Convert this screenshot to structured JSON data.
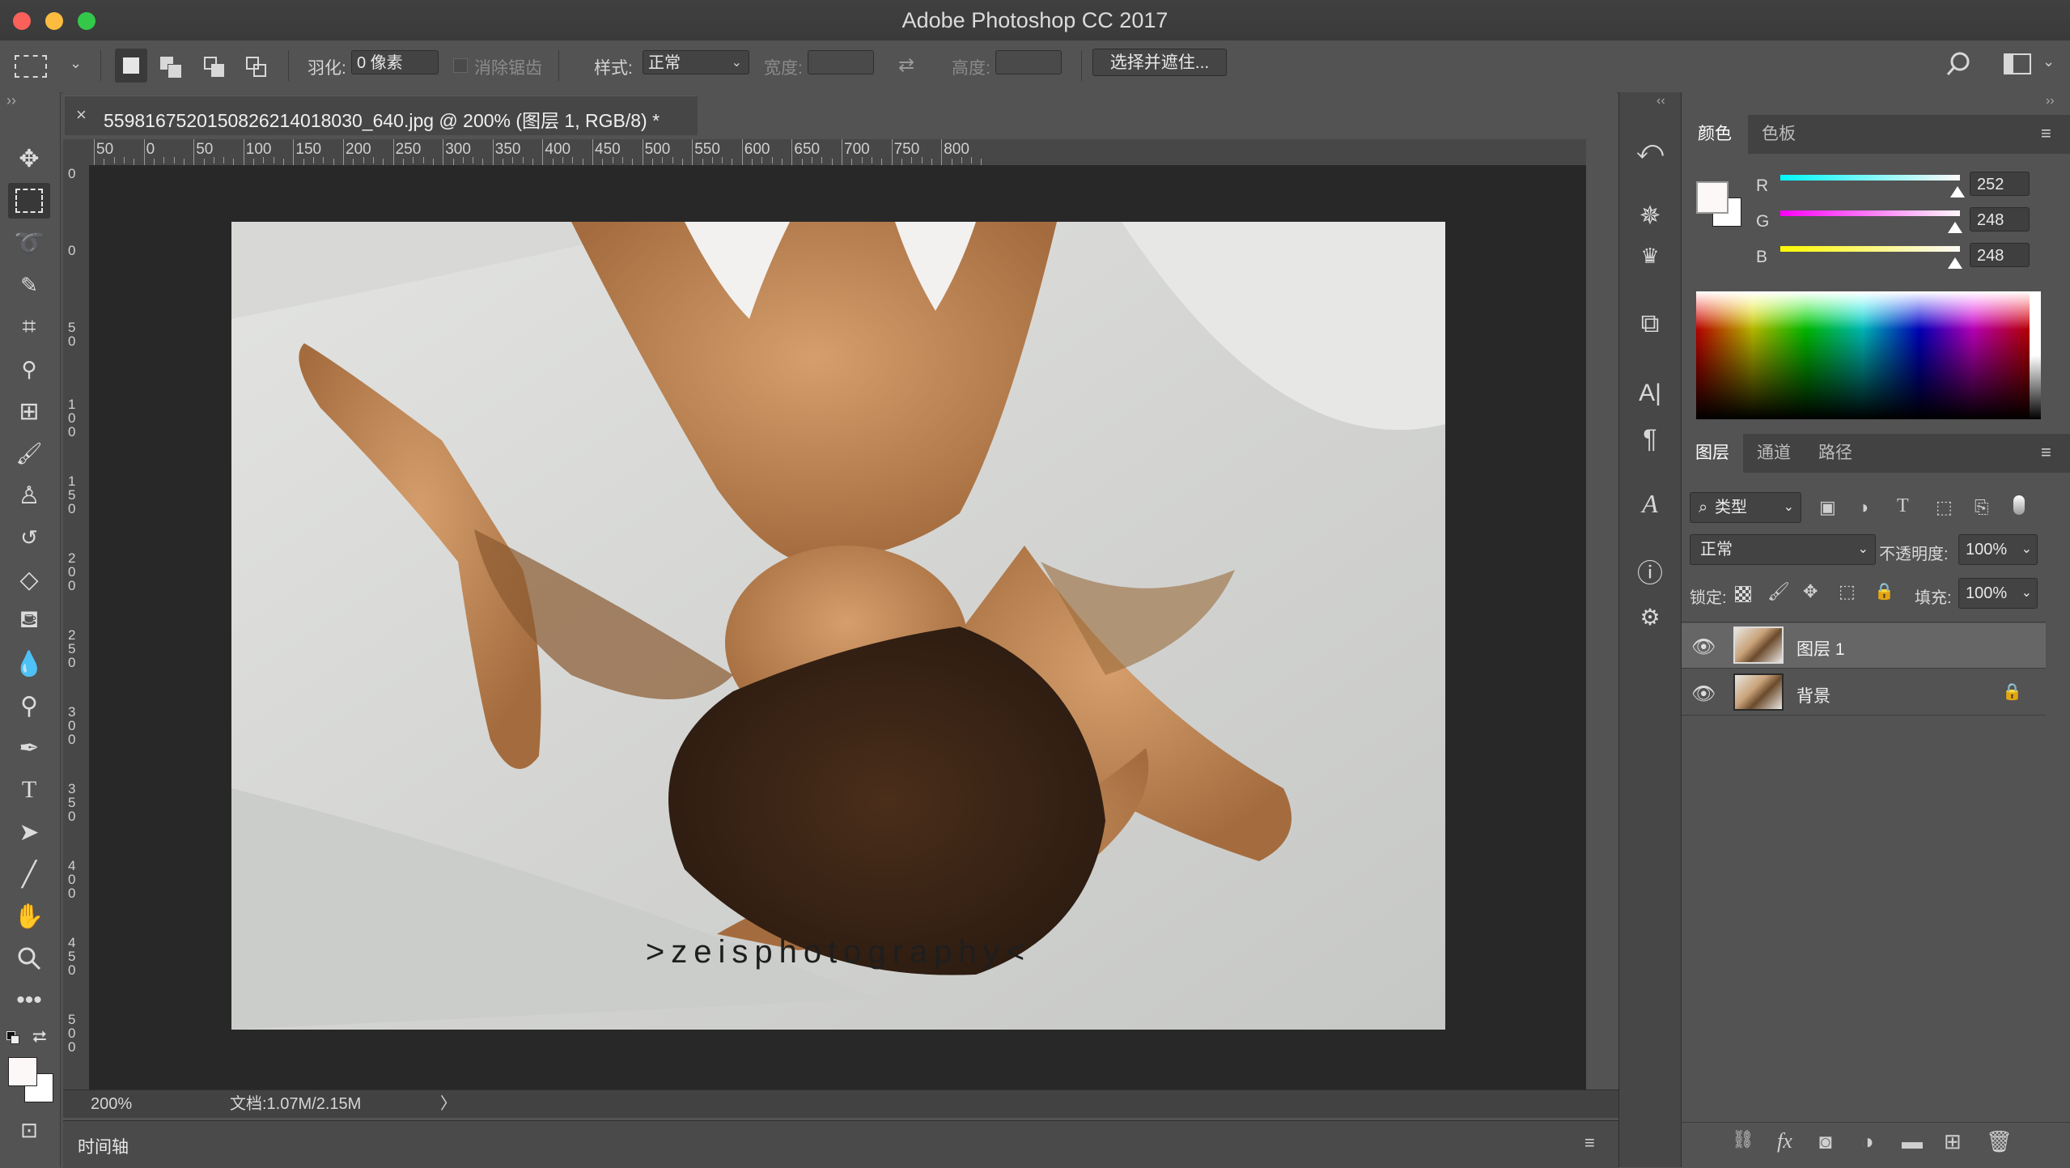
{
  "window": {
    "title": "Adobe Photoshop CC 2017"
  },
  "options": {
    "feather_label": "羽化:",
    "feather_value": "0 像素",
    "antialias_label": "消除锯齿",
    "style_label": "样式:",
    "style_value": "正常",
    "width_label": "宽度:",
    "height_label": "高度:",
    "select_mask_button": "选择并遮住..."
  },
  "document": {
    "tab_title": "5598167520150826214018030_640.jpg @ 200% (图层 1, RGB/8) *",
    "close_glyph": "×",
    "watermark": ">zeisphotography<"
  },
  "ruler_h": [
    "50",
    "0",
    "50",
    "100",
    "150",
    "200",
    "250",
    "300",
    "350",
    "400",
    "450",
    "500",
    "550",
    "600",
    "650",
    "700",
    "750",
    "800"
  ],
  "ruler_v": [
    "0",
    "0",
    "5 0",
    "1 0 0",
    "1 5 0",
    "2 0 0",
    "2 5 0",
    "3 0 0",
    "3 5 0",
    "4 0 0",
    "4 5 0",
    "5 0 0"
  ],
  "status": {
    "zoom": "200%",
    "doc_info": "文档:1.07M/2.15M",
    "arrow": "〉"
  },
  "timeline": {
    "label": "时间轴"
  },
  "color_panel": {
    "tabs": [
      "颜色",
      "色板"
    ],
    "r_label": "R",
    "g_label": "G",
    "b_label": "B",
    "r": "252",
    "g": "248",
    "b": "248",
    "r_fraction": 0.988,
    "g_fraction": 0.973,
    "b_fraction": 0.973
  },
  "layers_panel": {
    "tabs": [
      "图层",
      "通道",
      "路径"
    ],
    "filter_label": "类型",
    "blend_mode": "正常",
    "opacity_label": "不透明度:",
    "opacity_value": "100%",
    "lock_label": "锁定:",
    "fill_label": "填充:",
    "fill_value": "100%",
    "layers": [
      {
        "name": "图层 1",
        "selected": true,
        "locked": false
      },
      {
        "name": "背景",
        "selected": false,
        "locked": true
      }
    ],
    "footer_fx": "fx"
  },
  "colors": {
    "accent_red": "#fc605b",
    "accent_yellow": "#fdbc40",
    "accent_green": "#34c84a"
  }
}
